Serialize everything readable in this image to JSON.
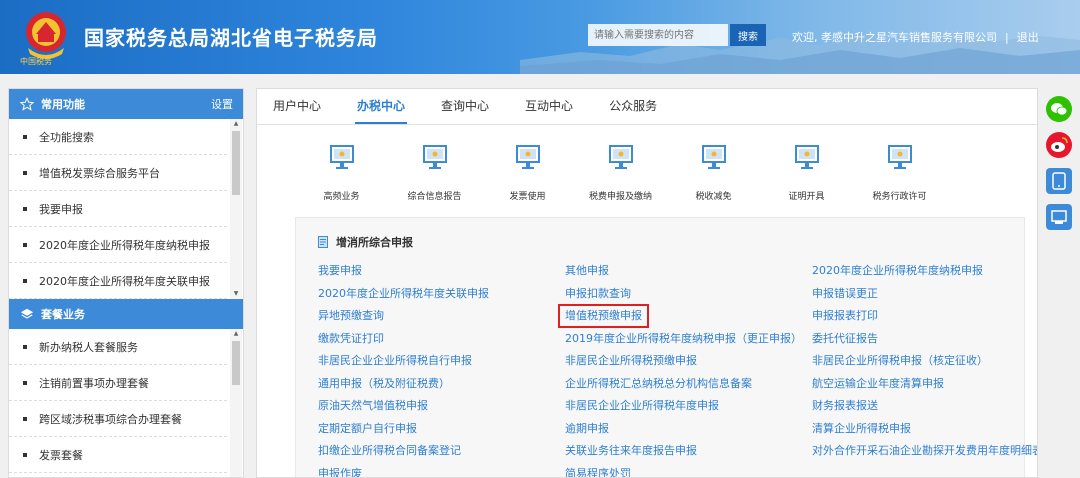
{
  "header": {
    "title": "国家税务总局湖北省电子税务局",
    "emblem_subtitle": "中国税务",
    "search_placeholder": "请输入需要搜索的内容",
    "search_button": "搜索",
    "welcome": "欢迎, 孝感中升之星汽车销售服务有限公司",
    "separator": "|",
    "logout": "退出"
  },
  "sidebar": {
    "common": {
      "title": "常用功能",
      "settings": "设置",
      "items": [
        "全功能搜索",
        "增值税发票综合服务平台",
        "我要申报",
        "2020年度企业所得税年度纳税申报",
        "2020年度企业所得税年度关联申报"
      ]
    },
    "package": {
      "title": "套餐业务",
      "items": [
        "新办纳税人套餐服务",
        "注销前置事项办理套餐",
        "跨区域涉税事项综合办理套餐",
        "发票套餐"
      ]
    }
  },
  "tabs": [
    {
      "label": "用户中心",
      "active": false
    },
    {
      "label": "办税中心",
      "active": true
    },
    {
      "label": "查询中心",
      "active": false
    },
    {
      "label": "互动中心",
      "active": false
    },
    {
      "label": "公众服务",
      "active": false
    }
  ],
  "services": [
    "高频业务",
    "综合信息报告",
    "发票使用",
    "税费申报及缴纳",
    "税收减免",
    "证明开具",
    "税务行政许可"
  ],
  "submenu": {
    "title": "增消所综合申报",
    "col1": [
      "我要申报",
      "2020年度企业所得税年度关联申报",
      "异地预缴查询",
      "缴款凭证打印",
      "非居民企业企业所得税自行申报",
      "通用申报（税及附征税费）",
      "原油天然气增值税申报",
      "定期定额户自行申报",
      "扣缴企业所得税合同备案登记",
      "申报作废"
    ],
    "col2": [
      "其他申报",
      "申报扣款查询",
      "增值税预缴申报",
      "2019年度企业所得税年度纳税申报（更正申报）",
      "非居民企业所得税预缴申报",
      "企业所得税汇总纳税总分机构信息备案",
      "非居民企业企业所得税年度申报",
      "逾期申报",
      "关联业务往来年度报告申报",
      "简易程序处罚"
    ],
    "col3": [
      "2020年度企业所得税年度纳税申报",
      "申报错误更正",
      "申报报表打印",
      "委托代征报告",
      "非居民企业所得税申报（核定征收）",
      "航空运输企业年度清算申报",
      "财务报表报送",
      "清算企业所得税申报",
      "对外合作开采石油企业勘探开发费用年度明细表"
    ]
  },
  "colors": {
    "accent": "#2f7fd0",
    "highlight_box": "#e02020",
    "sidebar_header": "#3d8bd8"
  },
  "float_icons": [
    "wechat-icon",
    "weibo-icon",
    "app-icon",
    "app-download-icon"
  ]
}
